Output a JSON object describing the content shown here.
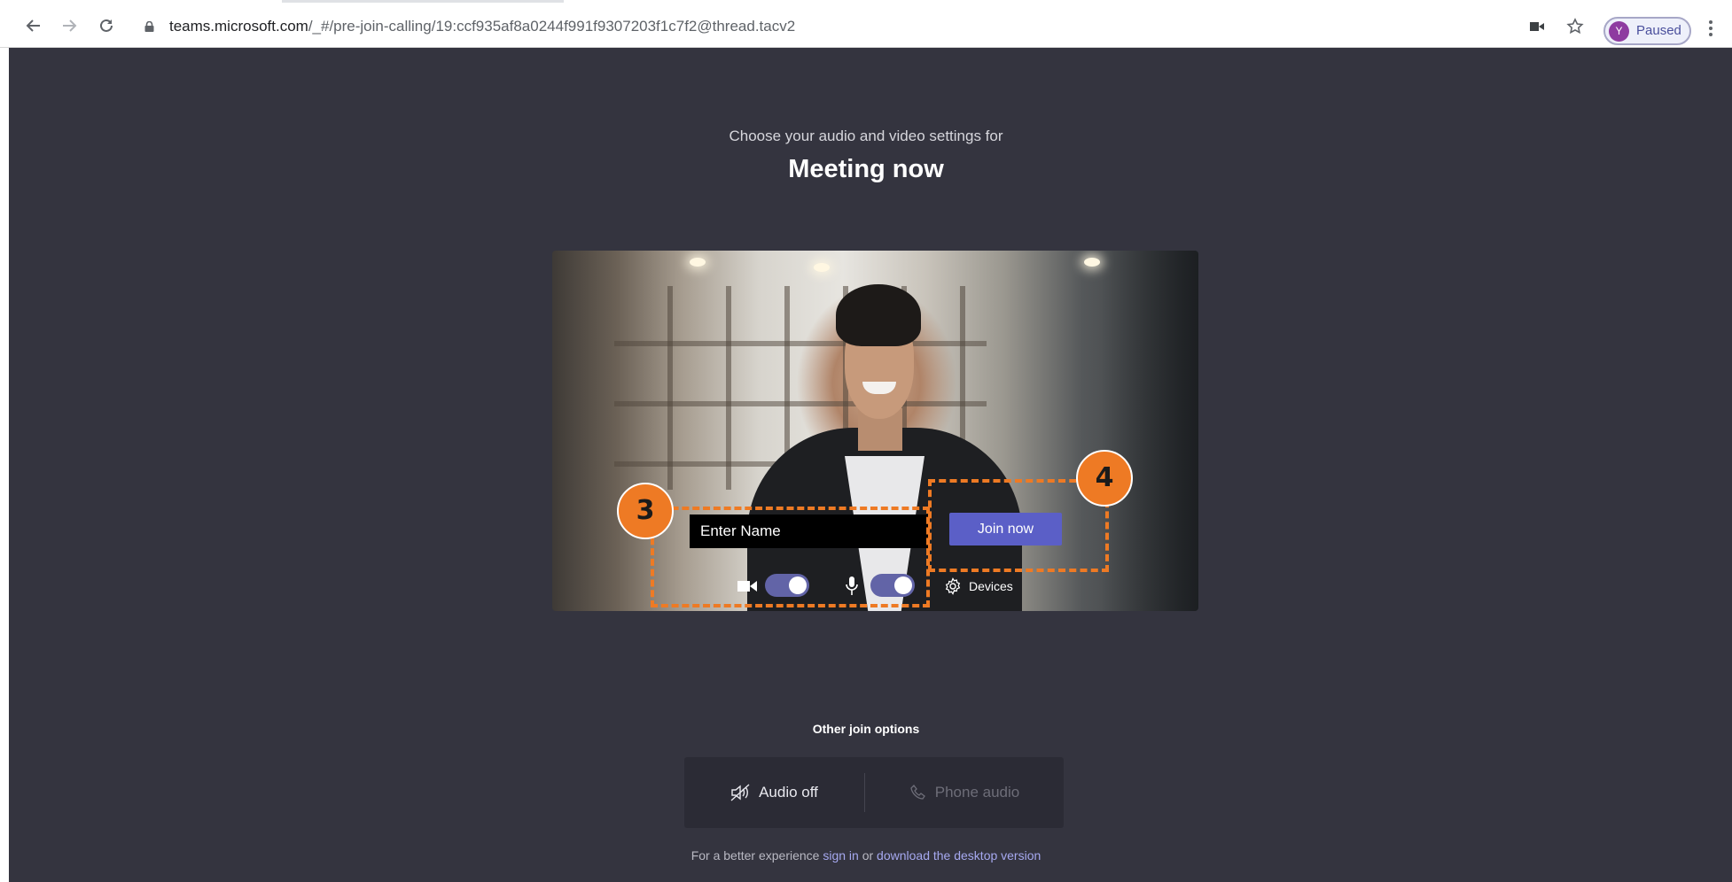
{
  "browser": {
    "url_host": "teams.microsoft.com",
    "url_path": "/_#/pre-join-calling/19:ccf935af8a0244f991f9307203f1c7f2@thread.tacv2",
    "profile_initial": "Y",
    "profile_status": "Paused",
    "icons": [
      "back-icon",
      "forward-icon",
      "reload-icon",
      "lock-icon",
      "camera-icon",
      "star-icon",
      "menu-icon"
    ]
  },
  "prejoin": {
    "subtitle": "Choose your audio and video settings for",
    "meeting_title": "Meeting now",
    "name_placeholder": "Enter Name",
    "join_label": "Join now",
    "camera_on": true,
    "mic_on": true,
    "devices_label": "Devices"
  },
  "annotations": {
    "step_name": "3",
    "step_join": "4",
    "color": "#ee7a24"
  },
  "other_options": {
    "title": "Other join options",
    "audio_off_label": "Audio off",
    "phone_audio_label": "Phone audio"
  },
  "footer": {
    "prefix": "For a better experience ",
    "sign_in": "sign in",
    "middle": " or ",
    "download": "download the desktop version"
  },
  "colors": {
    "page_bg": "#34343f",
    "accent": "#5b5fc7",
    "toggle": "#6264a7"
  }
}
